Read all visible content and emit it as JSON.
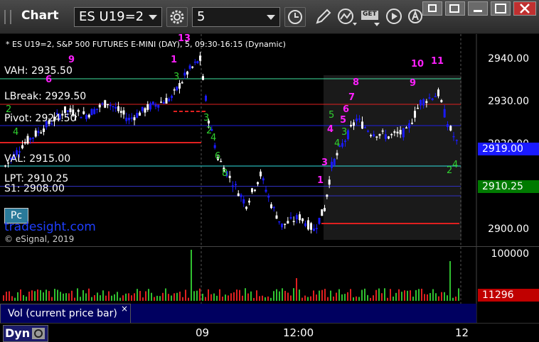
{
  "toolbar": {
    "title": "Chart",
    "symbol": "ES U19=2",
    "interval": "5",
    "get_label": "GET"
  },
  "chart": {
    "heading": "* ES U19=2, S&P 500 FUTURES E-MINI (DAY), 5, 09:30-16:15 (Dynamic)",
    "levels": [
      {
        "label": "VAH: 2935.50",
        "price": 2935.5,
        "color": "#40e0a0"
      },
      {
        "label": "LBreak: 2929.50",
        "price": 2929.5,
        "color": "#e02020"
      },
      {
        "label": "Pivot: 2924.50",
        "price": 2924.5,
        "color": "#2020e0"
      },
      {
        "label": "VAL: 2915.00",
        "price": 2915.0,
        "color": "#30e0e0"
      },
      {
        "label": "LPT: 2910.25",
        "price": 2910.25,
        "color": "#3030c0"
      },
      {
        "label": "S1: 2908.00",
        "price": 2908.0,
        "color": "#3030c0"
      }
    ],
    "axis_prices": [
      "2940.00",
      "2930.00",
      "2920.00",
      "2900.00"
    ],
    "last_price": "2919.00",
    "lpt_price": "2910.25",
    "badge": "Pc",
    "brand": "tradesight.com",
    "copyright": "© eSignal, 2019",
    "colors": {
      "up": "#ffffff",
      "down": "#1a1aff",
      "tag_last": "#1a1aff",
      "tag_lpt": "#007a00",
      "vol_tag": "#c00000"
    }
  },
  "volume": {
    "legend": "Vol (current price bar)",
    "axis_label": "100000",
    "last_value": "11296",
    "close": "×"
  },
  "time_axis": {
    "labels": [
      "09",
      "12:00",
      "12"
    ],
    "mode": "Dyn"
  }
}
